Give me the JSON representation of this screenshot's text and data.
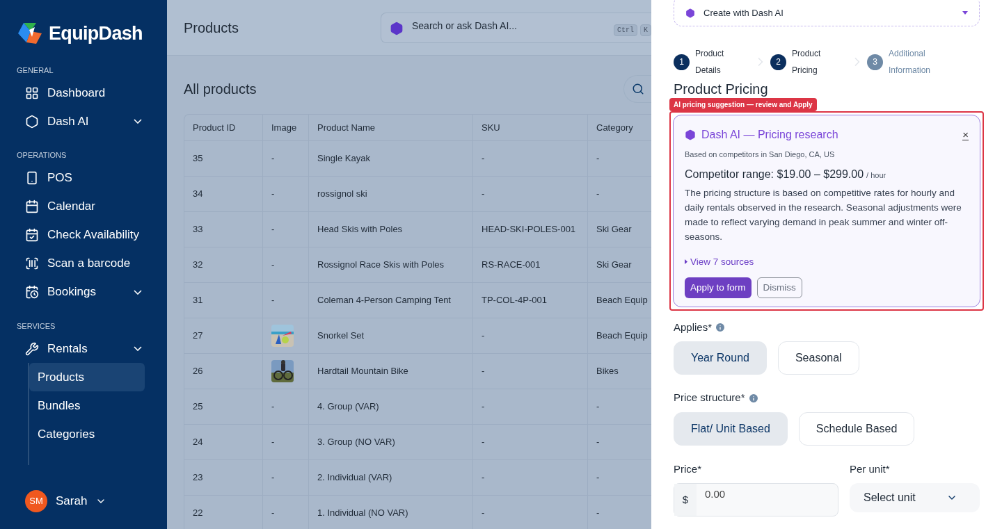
{
  "brand": {
    "name": "EquipDash"
  },
  "sidebar": {
    "sections": [
      {
        "title": "GENERAL",
        "items": [
          {
            "label": "Dashboard",
            "has_menu": false
          },
          {
            "label": "Dash AI",
            "has_menu": true
          }
        ]
      },
      {
        "title": "OPERATIONS",
        "items": [
          {
            "label": "POS",
            "has_menu": false
          },
          {
            "label": "Calendar",
            "has_menu": false
          },
          {
            "label": "Check Availability",
            "has_menu": false
          },
          {
            "label": "Scan a barcode",
            "has_menu": false
          },
          {
            "label": "Bookings",
            "has_menu": true
          }
        ]
      },
      {
        "title": "SERVICES",
        "items": [
          {
            "label": "Rentals",
            "has_menu": true,
            "children": [
              {
                "label": "Products",
                "selected": true
              },
              {
                "label": "Bundles",
                "selected": false
              },
              {
                "label": "Categories",
                "selected": false
              }
            ]
          }
        ]
      }
    ],
    "user": {
      "initials": "SM",
      "name": "Sarah"
    }
  },
  "header": {
    "title": "Products",
    "search": {
      "placeholder": "Search or ask Dash AI...",
      "keys": [
        "Ctrl",
        "K"
      ]
    }
  },
  "table": {
    "title": "All products",
    "columns": [
      "Product ID",
      "Image",
      "Product Name",
      "SKU",
      "Category"
    ],
    "rows": [
      {
        "id": "35",
        "image": "-",
        "name": "Single Kayak",
        "sku": "-",
        "category": "-"
      },
      {
        "id": "34",
        "image": "-",
        "name": "rossignol ski",
        "sku": "-",
        "category": "-"
      },
      {
        "id": "33",
        "image": "-",
        "name": "Head Skis with Poles",
        "sku": "HEAD-SKI-POLES-001",
        "category": "Ski Gear"
      },
      {
        "id": "32",
        "image": "-",
        "name": "Rossignol Race Skis with Poles",
        "sku": "RS-RACE-001",
        "category": "Ski Gear"
      },
      {
        "id": "31",
        "image": "-",
        "name": "Coleman 4-Person Camping Tent",
        "sku": "TP-COL-4P-001",
        "category": "Beach Equip"
      },
      {
        "id": "27",
        "name": "Snorkel Set",
        "sku": "-",
        "category": "Beach Equip"
      },
      {
        "id": "26",
        "name": "Hardtail Mountain Bike",
        "sku": "-",
        "category": "Bikes"
      },
      {
        "id": "25",
        "image": "-",
        "name": "4. Group (VAR)",
        "sku": "-",
        "category": "-"
      },
      {
        "id": "24",
        "image": "-",
        "name": "3. Group (NO VAR)",
        "sku": "-",
        "category": "-"
      },
      {
        "id": "23",
        "image": "-",
        "name": "2. Individual (VAR)",
        "sku": "-",
        "category": "-"
      },
      {
        "id": "22",
        "image": "-",
        "name": "1. Individual (NO VAR)",
        "sku": "-",
        "category": "-"
      }
    ]
  },
  "drawer": {
    "ai_dropdown": "Create with Dash AI",
    "steps": [
      {
        "number": "1",
        "label": "Product Details",
        "active": true
      },
      {
        "number": "2",
        "label": "Product Pricing",
        "active": true
      },
      {
        "number": "3",
        "label": "Additional Information",
        "active": false
      }
    ],
    "heading": "Product Pricing",
    "annotation": "AI pricing suggestion — review and Apply",
    "ai_card": {
      "title": "Dash AI — Pricing research",
      "close": "×",
      "location": "Based on competitors in San Diego, CA, US",
      "range": "Competitor range: $19.00 – $299.00",
      "range_unit": "/ hour",
      "body": "The pricing structure is based on competitive rates for hourly and daily rentals observed in the research. Seasonal adjustments were made to reflect varying demand in peak summer and winter off-seasons.",
      "sources": "View 7 sources",
      "apply": "Apply to form",
      "dismiss": "Dismiss"
    },
    "applies": {
      "label": "Applies*",
      "options": [
        {
          "label": "Year Round",
          "selected": true
        },
        {
          "label": "Seasonal",
          "selected": false
        }
      ]
    },
    "price_structure": {
      "label": "Price structure*",
      "options": [
        {
          "label": "Flat/ Unit Based",
          "selected": true
        },
        {
          "label": "Schedule Based",
          "selected": false
        }
      ]
    },
    "price": {
      "label": "Price*",
      "currency": "$",
      "value": "0.00"
    },
    "per_unit": {
      "label": "Per unit*",
      "placeholder": "Select unit"
    }
  }
}
